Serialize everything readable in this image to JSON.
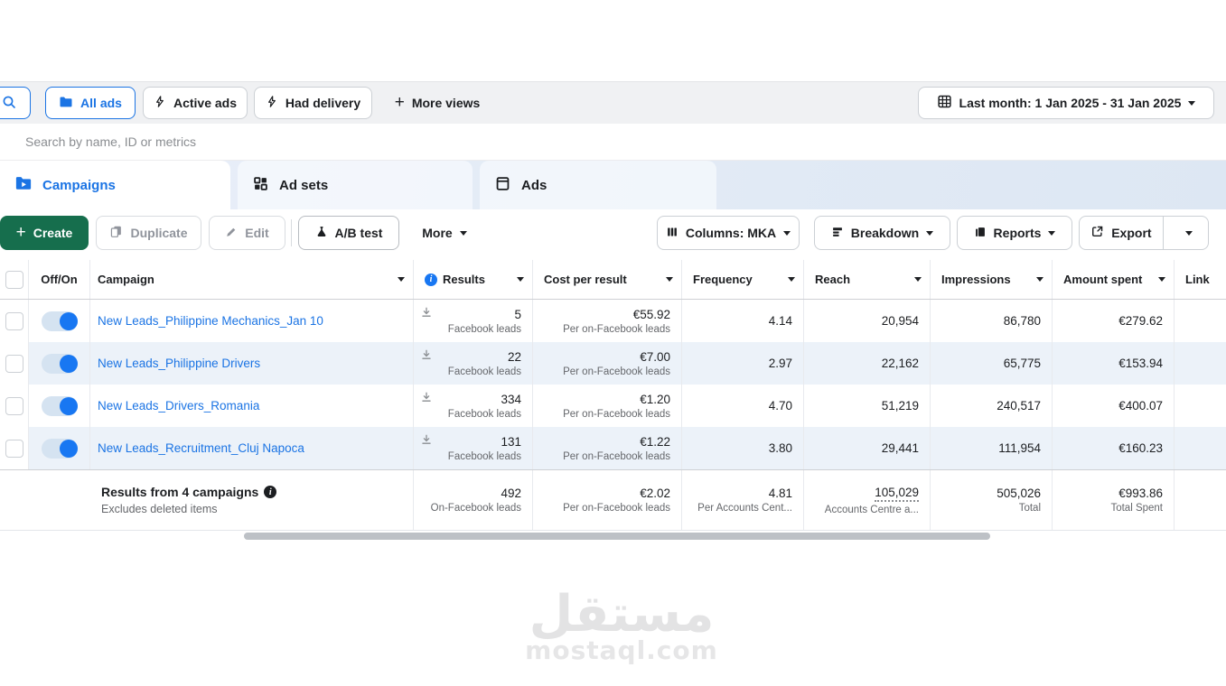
{
  "toolbar": {
    "all_ads": "All ads",
    "active_ads": "Active ads",
    "had_delivery": "Had delivery",
    "more_views": "More views",
    "date_range": "Last month: 1 Jan 2025 - 31 Jan 2025"
  },
  "search": {
    "placeholder": "Search by name, ID or metrics"
  },
  "tabs": {
    "campaigns": "Campaigns",
    "ad_sets": "Ad sets",
    "ads": "Ads"
  },
  "actions": {
    "create": "Create",
    "duplicate": "Duplicate",
    "edit": "Edit",
    "ab_test": "A/B test",
    "more": "More",
    "columns": "Columns: MKA",
    "breakdown": "Breakdown",
    "reports": "Reports",
    "export": "Export"
  },
  "table": {
    "headers": {
      "off_on": "Off/On",
      "campaign": "Campaign",
      "results": "Results",
      "cost_per_result": "Cost per result",
      "frequency": "Frequency",
      "reach": "Reach",
      "impressions": "Impressions",
      "amount_spent": "Amount spent",
      "link": "Link"
    },
    "rows": [
      {
        "name": "New Leads_Philippine Mechanics_Jan 10",
        "toggle_on": true,
        "results": "5",
        "results_label": "Facebook leads",
        "cost": "€55.92",
        "cost_label": "Per on-Facebook leads",
        "frequency": "4.14",
        "reach": "20,954",
        "impressions": "86,780",
        "spent": "€279.62"
      },
      {
        "name": "New Leads_Philippine Drivers",
        "toggle_on": true,
        "results": "22",
        "results_label": "Facebook leads",
        "cost": "€7.00",
        "cost_label": "Per on-Facebook leads",
        "frequency": "2.97",
        "reach": "22,162",
        "impressions": "65,775",
        "spent": "€153.94"
      },
      {
        "name": "New Leads_Drivers_Romania",
        "toggle_on": true,
        "results": "334",
        "results_label": "Facebook leads",
        "cost": "€1.20",
        "cost_label": "Per on-Facebook leads",
        "frequency": "4.70",
        "reach": "51,219",
        "impressions": "240,517",
        "spent": "€400.07"
      },
      {
        "name": "New Leads_Recruitment_Cluj Napoca",
        "toggle_on": true,
        "results": "131",
        "results_label": "Facebook leads",
        "cost": "€1.22",
        "cost_label": "Per on-Facebook leads",
        "frequency": "3.80",
        "reach": "29,441",
        "impressions": "111,954",
        "spent": "€160.23"
      }
    ],
    "summary": {
      "title": "Results from 4 campaigns",
      "subtitle": "Excludes deleted items",
      "results": "492",
      "results_label": "On-Facebook leads",
      "cost": "€2.02",
      "cost_label": "Per on-Facebook leads",
      "frequency": "4.81",
      "frequency_label": "Per Accounts Cent...",
      "reach": "105,029",
      "reach_label": "Accounts Centre a...",
      "impressions": "505,026",
      "impressions_label": "Total",
      "spent": "€993.86",
      "spent_label": "Total Spent"
    }
  },
  "watermark": {
    "arabic": "مستقل",
    "domain": "mostaql.com"
  },
  "colors": {
    "accent_blue": "#1b74e4",
    "toggle_blue": "#1877f2",
    "create_green": "#166e4d",
    "tab_band": "#e3ebf6",
    "row_alt": "#ecf2f9"
  }
}
